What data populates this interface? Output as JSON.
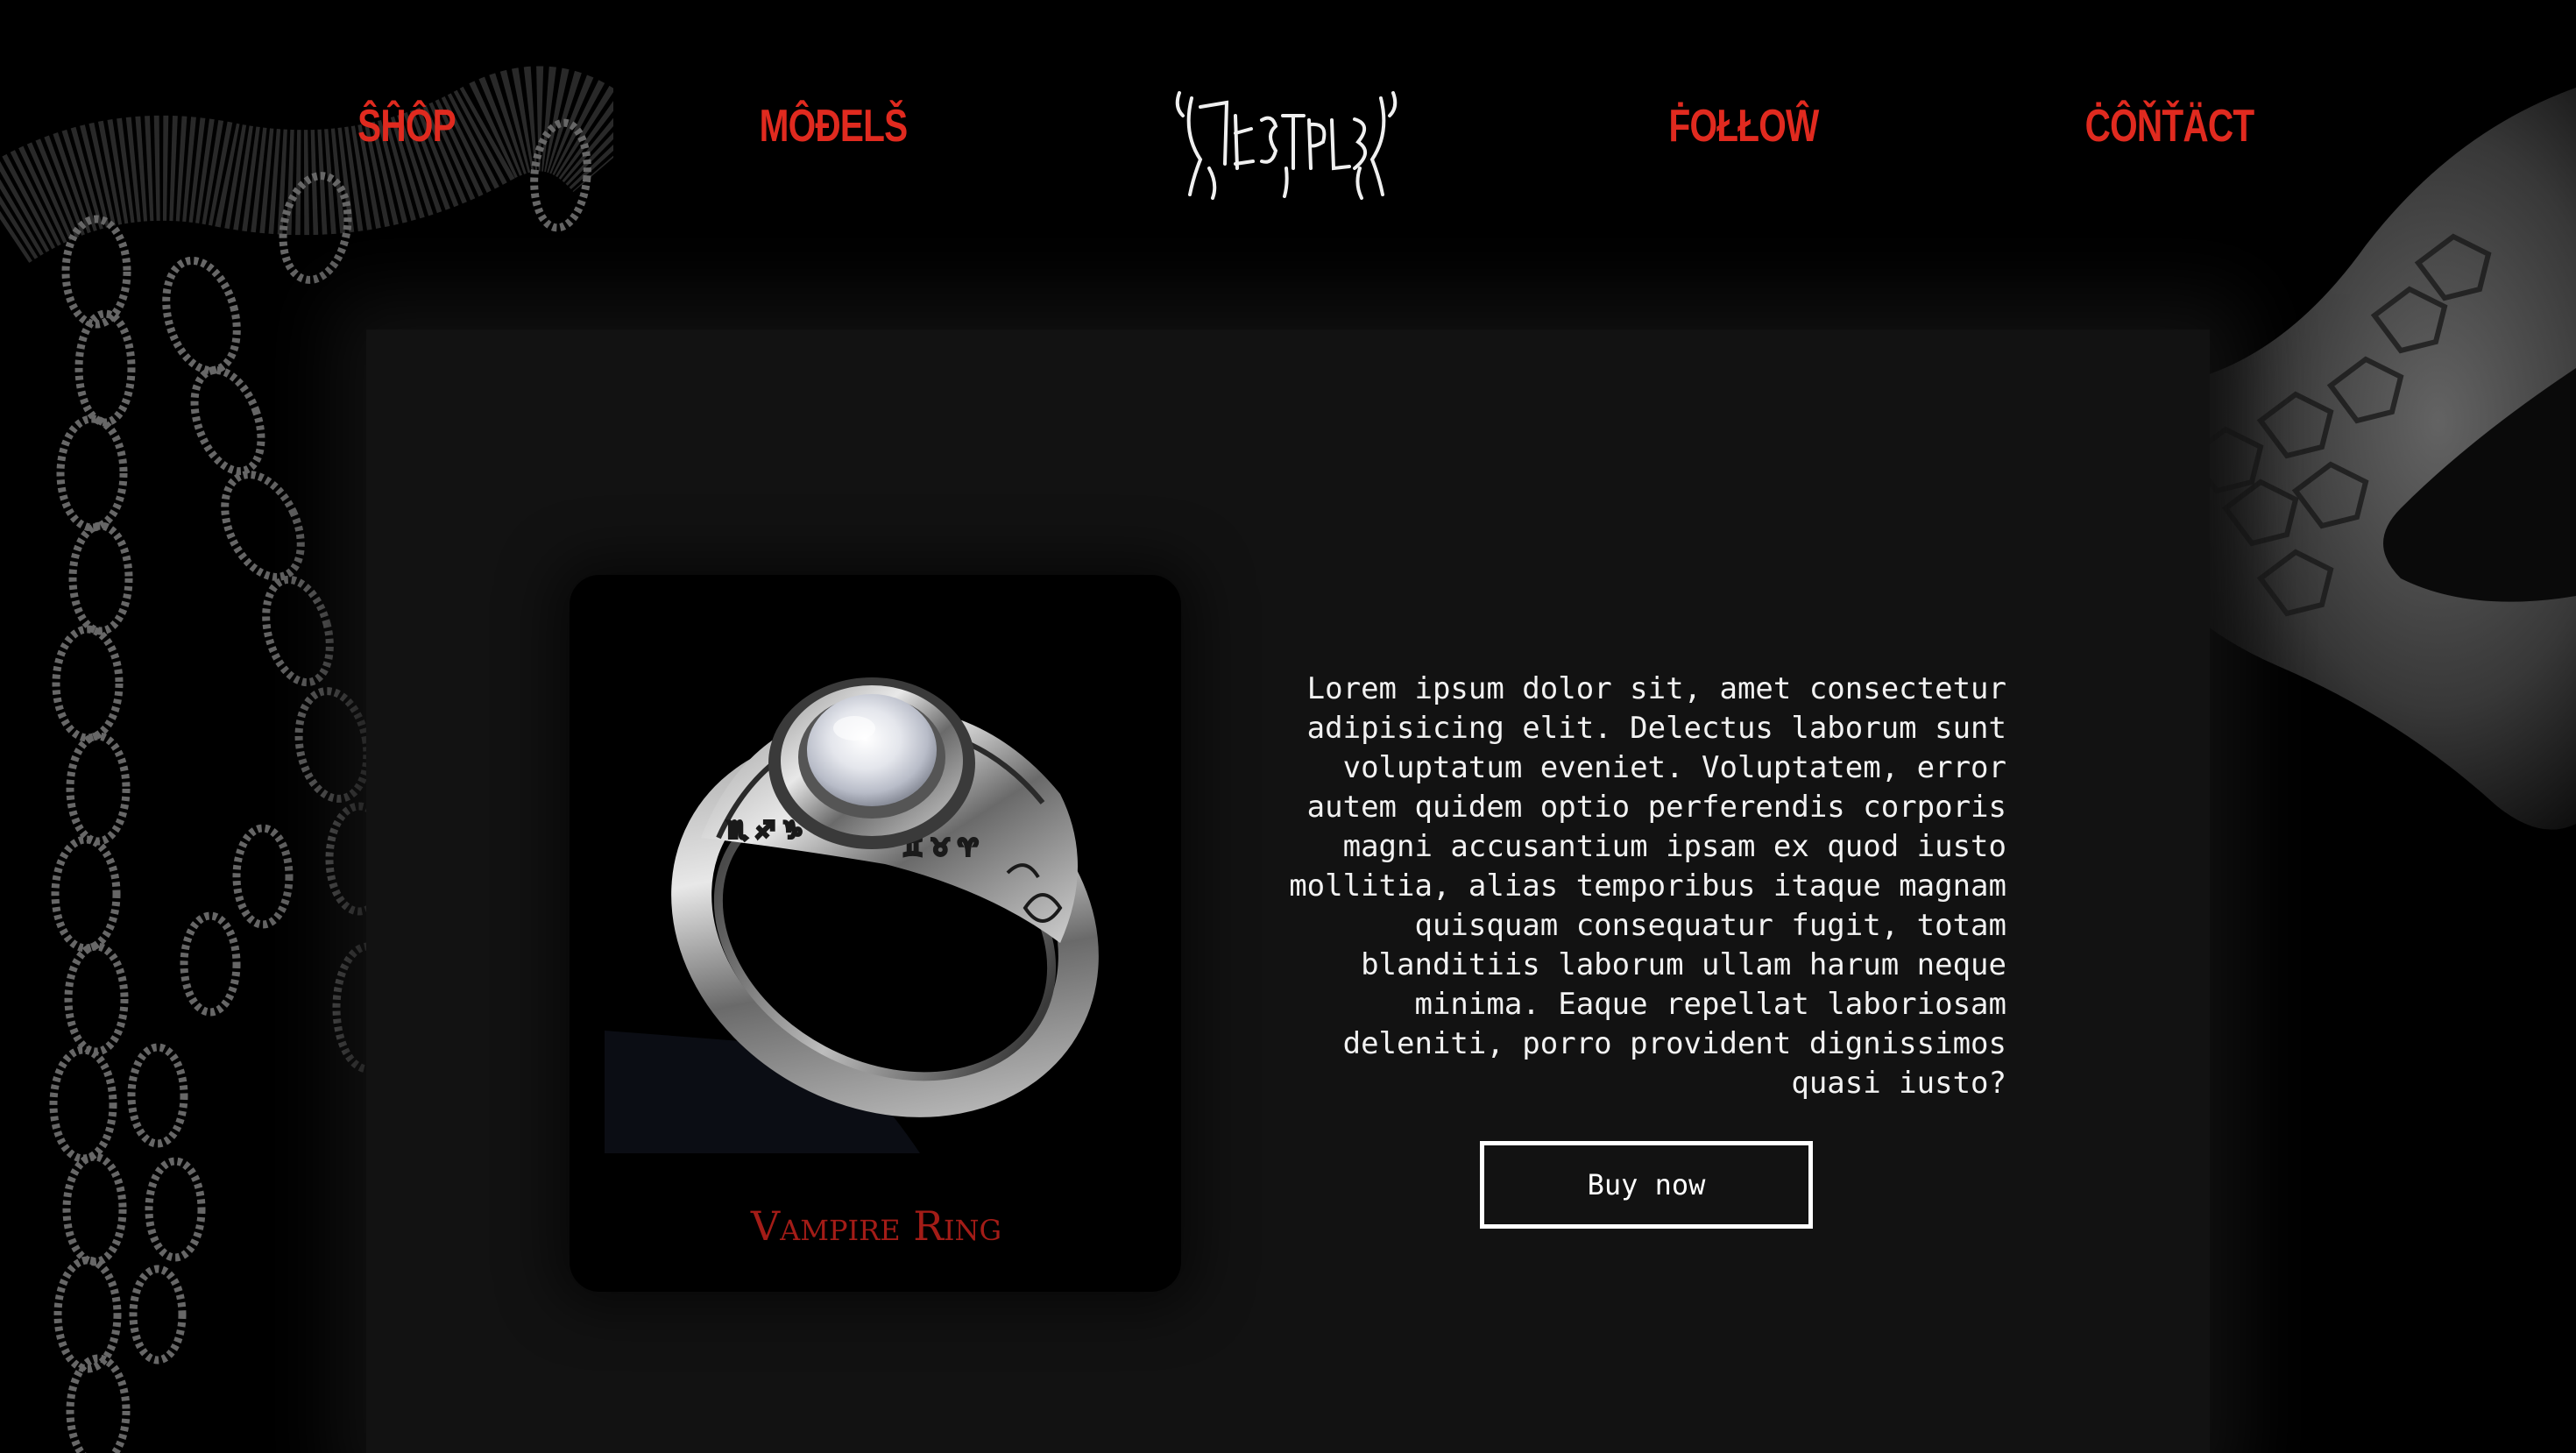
{
  "nav": {
    "items": [
      {
        "id": "shop",
        "label": "ŜĤÔP"
      },
      {
        "id": "models",
        "label": "MÔĐELŠ"
      },
      {
        "id": "follow",
        "label": "ḞOŁŁOŴ"
      },
      {
        "id": "contact",
        "label": "ĊÔŇŤÄCT"
      }
    ],
    "logo_icon": "band-logo-icon"
  },
  "product": {
    "name": "Vampire Ring",
    "image_icon": "silver-moonstone-ring-icon",
    "description": "Lorem ipsum dolor sit, amet consectetur adipisicing elit. Delectus laborum sunt voluptatum eveniet. Voluptatem, error autem quidem optio perferendis corporis magni accusantium ipsam ex quod iusto mollitia, alias temporibus itaque magnam quisquam consequatur fugit, totam blanditiis laborum ullam harum neque minima. Eaque repellat laboriosam deleniti, porro provident dignissimos quasi iusto?",
    "buy_label": "Buy now"
  },
  "colors": {
    "background": "#000000",
    "panel": "#121212",
    "accent_red": "#e02a1f",
    "product_name_red": "#a31c17",
    "text": "#f2f2f2"
  }
}
